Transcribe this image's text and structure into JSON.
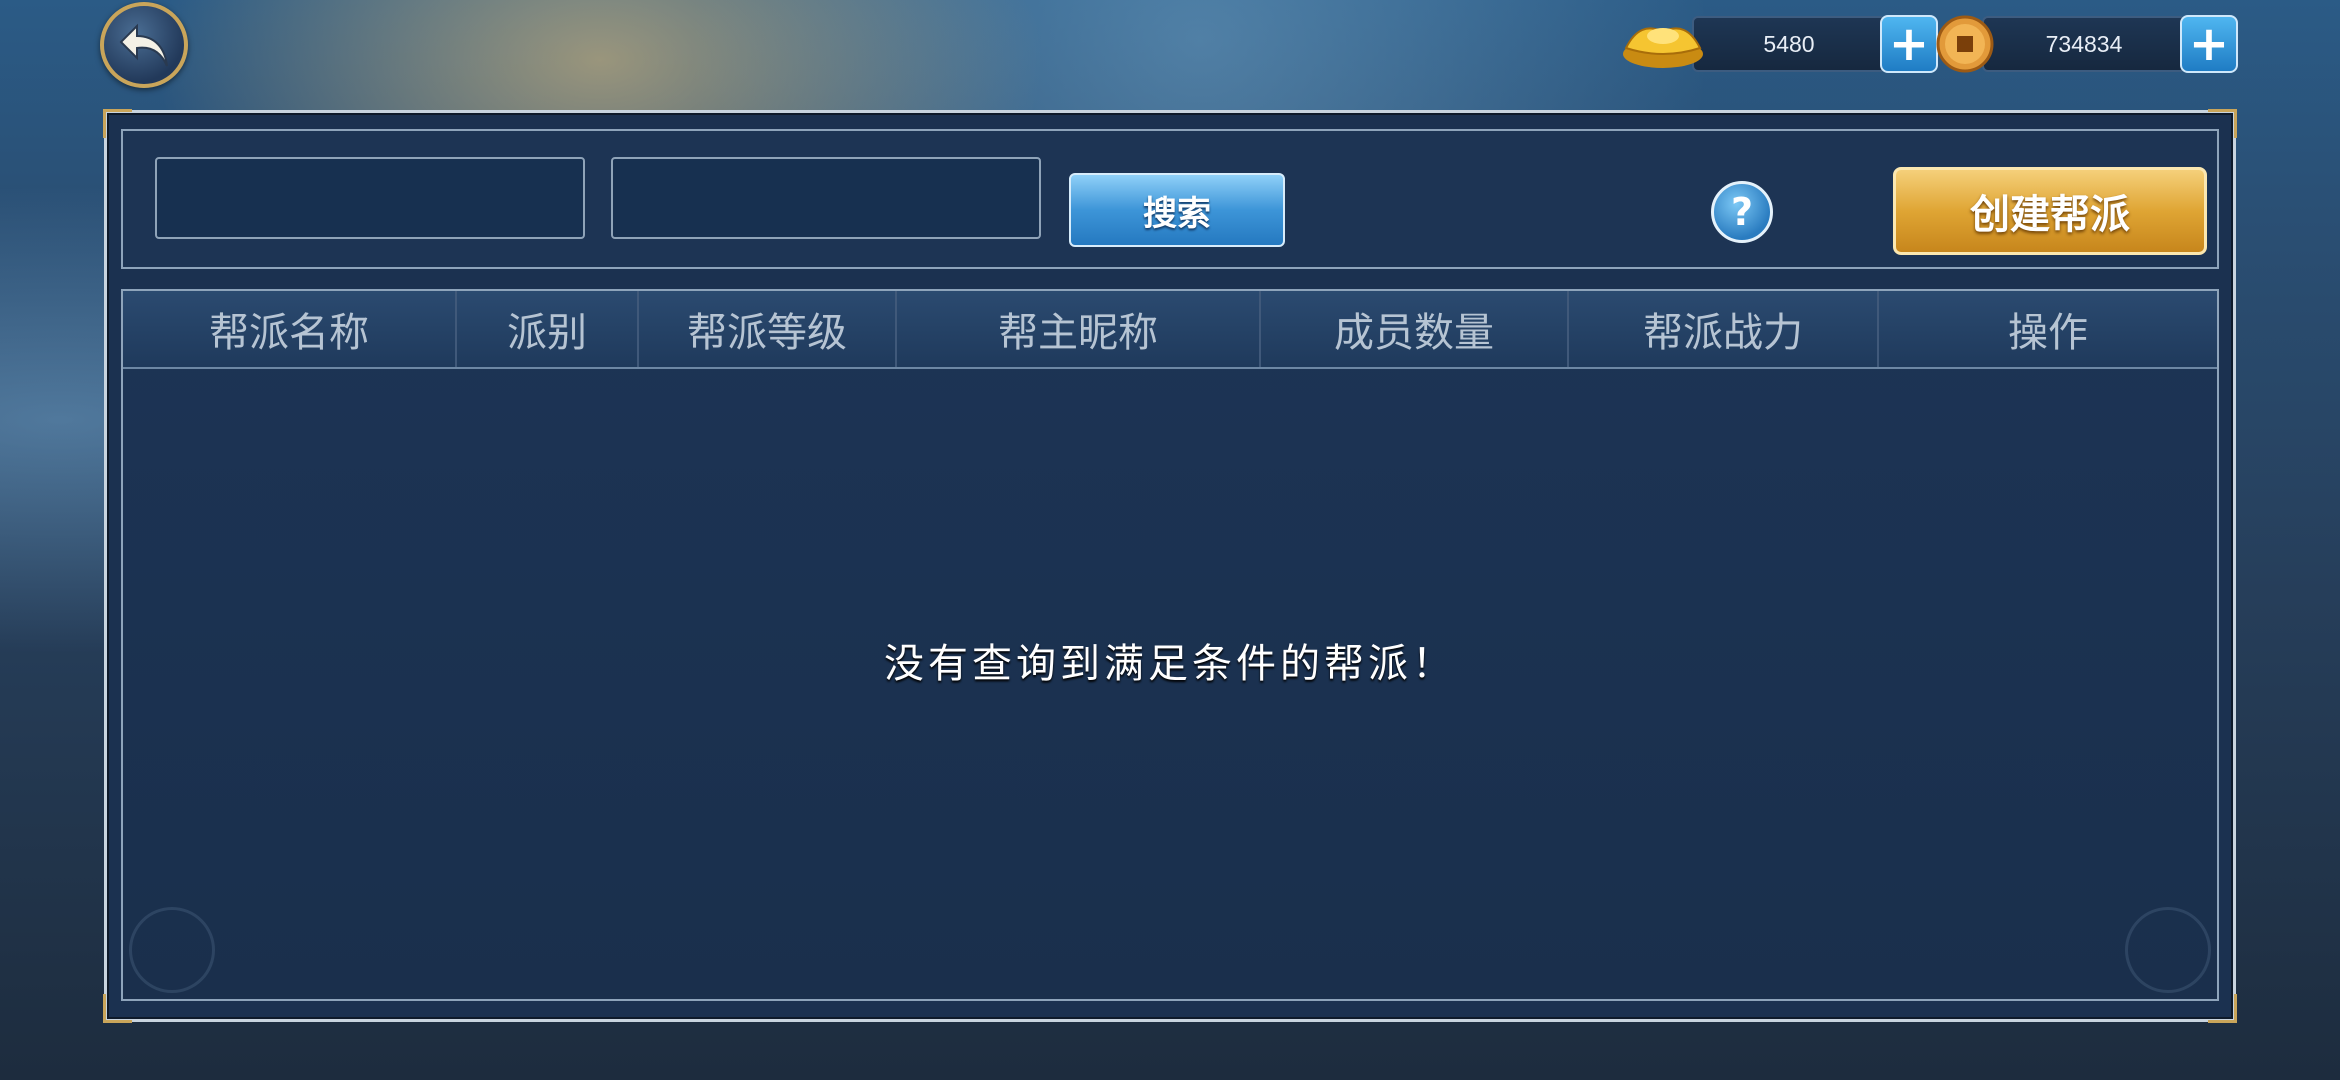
{
  "topbar": {
    "gold_amount": "5480",
    "coin_amount": "734834",
    "plus_label": "+"
  },
  "search": {
    "input1_value": "",
    "input2_value": "",
    "button_label": "搜索"
  },
  "help_label": "?",
  "create_button_label": "创建帮派",
  "table": {
    "headers": [
      "帮派名称",
      "派别",
      "帮派等级",
      "帮主昵称",
      "成员数量",
      "帮派战力",
      "操作"
    ]
  },
  "empty_message": "没有查询到满足条件的帮派！",
  "colors": {
    "panel": "#1b3150",
    "search_button": "#3d95d8",
    "create_button": "#dfa534",
    "frame_gold": "#c9a55a"
  },
  "icons": [
    "back-arrow-icon",
    "gold-ingot-icon",
    "copper-coin-icon",
    "plus-icon",
    "help-icon"
  ]
}
